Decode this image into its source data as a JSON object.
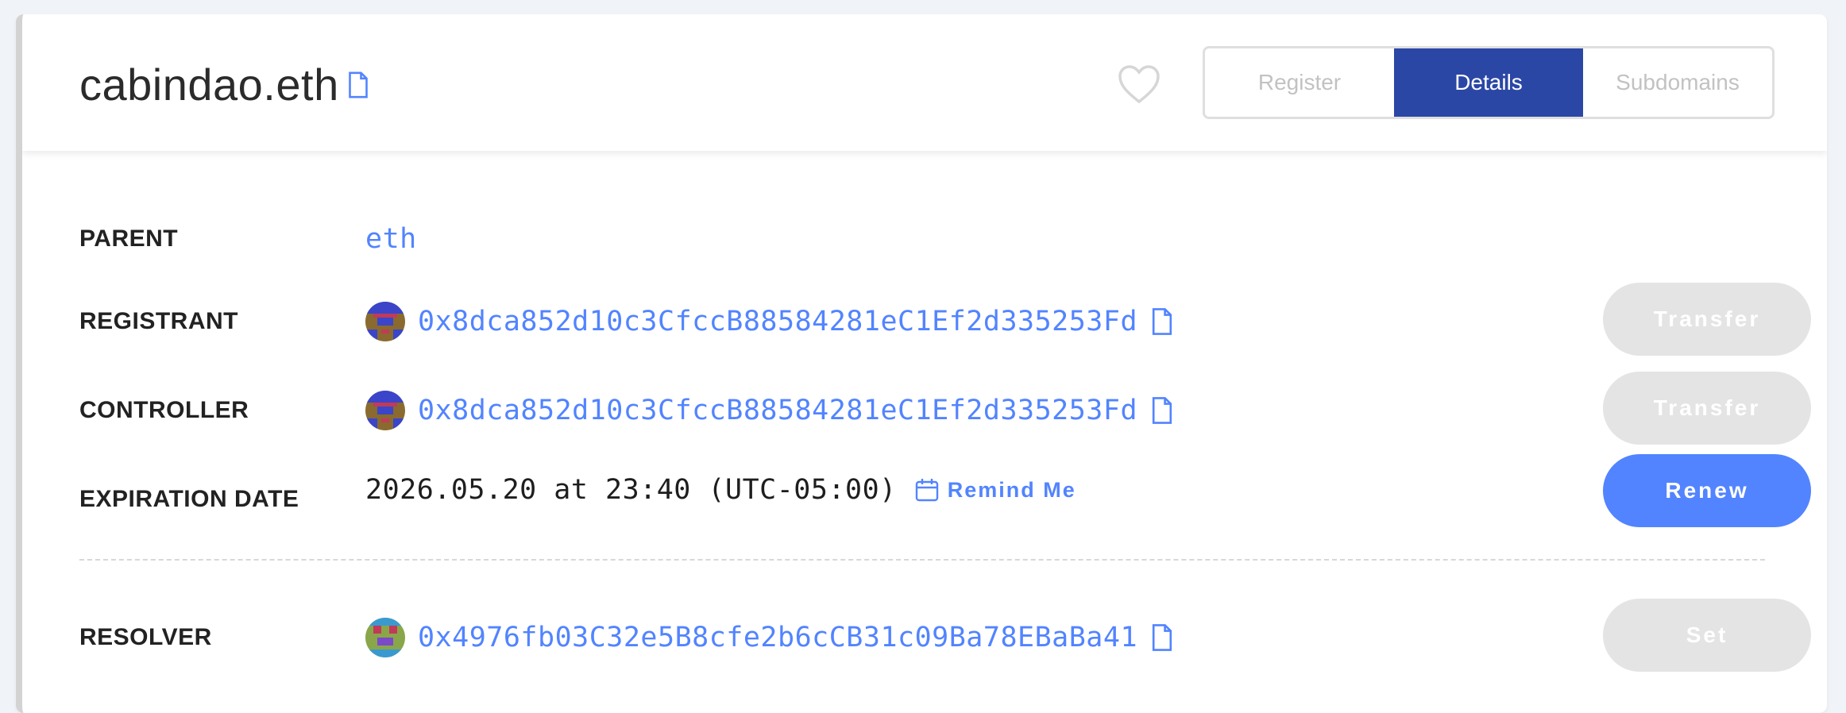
{
  "header": {
    "domain": "cabindao.eth",
    "tabs": [
      {
        "label": "Register",
        "active": false
      },
      {
        "label": "Details",
        "active": true
      },
      {
        "label": "Subdomains",
        "active": false
      }
    ]
  },
  "details": {
    "parent": {
      "label": "PARENT",
      "value": "eth"
    },
    "registrant": {
      "label": "REGISTRANT",
      "address": "0x8dca852d10c3CfccB88584281eC1Ef2d335253Fd",
      "button": "Transfer"
    },
    "controller": {
      "label": "CONTROLLER",
      "address": "0x8dca852d10c3CfccB88584281eC1Ef2d335253Fd",
      "button": "Transfer"
    },
    "expiration": {
      "label": "EXPIRATION DATE",
      "value": "2026.05.20 at 23:40 (UTC-05:00)",
      "remind": "Remind Me",
      "button": "Renew"
    },
    "resolver": {
      "label": "RESOLVER",
      "address": "0x4976fb03C32e5B8cfe2b6cCB31c09Ba78EBaBa41",
      "button": "Set"
    }
  },
  "colors": {
    "accent": "#5284ff",
    "tab_active": "#2b47a6",
    "disabled": "#e4e4e4"
  },
  "icons": [
    "copy-icon",
    "heart-icon",
    "calendar-icon",
    "avatar-icon"
  ]
}
